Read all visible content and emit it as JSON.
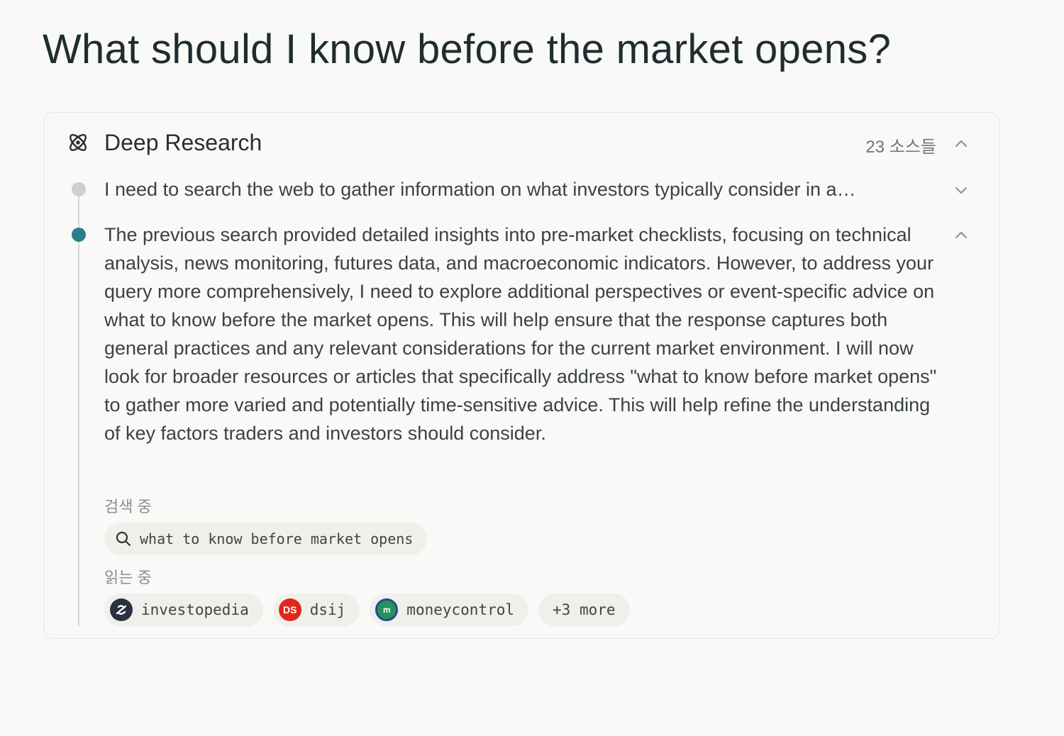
{
  "query": {
    "title": "What should I know before the market opens?"
  },
  "research_card": {
    "title": "Deep Research",
    "sources_count": "23 소스들",
    "steps": [
      {
        "status": "done",
        "text": "I need to search the web to gather information on what investors typically consider in a…"
      },
      {
        "status": "active",
        "text": "The previous search provided detailed insights into pre-market checklists, focusing on technical analysis, news monitoring, futures data, and macroeconomic indicators. However, to address your query more comprehensively, I need to explore additional perspectives or event-specific advice on what to know before the market opens. This will help ensure that the response captures both general practices and any relevant considerations for the current market environment. I will now look for broader resources or articles that specifically address \"what to know before market opens\" to gather more varied and potentially time-sensitive advice. This will help refine the understanding of key factors traders and investors should consider."
      }
    ],
    "searching_label": "검색 중",
    "search_query": "what to know before market opens",
    "reading_label": "읽는 중",
    "sources": [
      {
        "name": "investopedia",
        "icon": "investopedia-favicon"
      },
      {
        "name": "dsij",
        "icon": "dsij-favicon",
        "badge": "DS"
      },
      {
        "name": "moneycontrol",
        "icon": "moneycontrol-favicon",
        "badge": "m"
      }
    ],
    "more_label": "+3 more"
  },
  "colors": {
    "background": "#f9f9f7",
    "accent_dot": "#2a7f8c",
    "chip_bg": "#efefeb"
  }
}
